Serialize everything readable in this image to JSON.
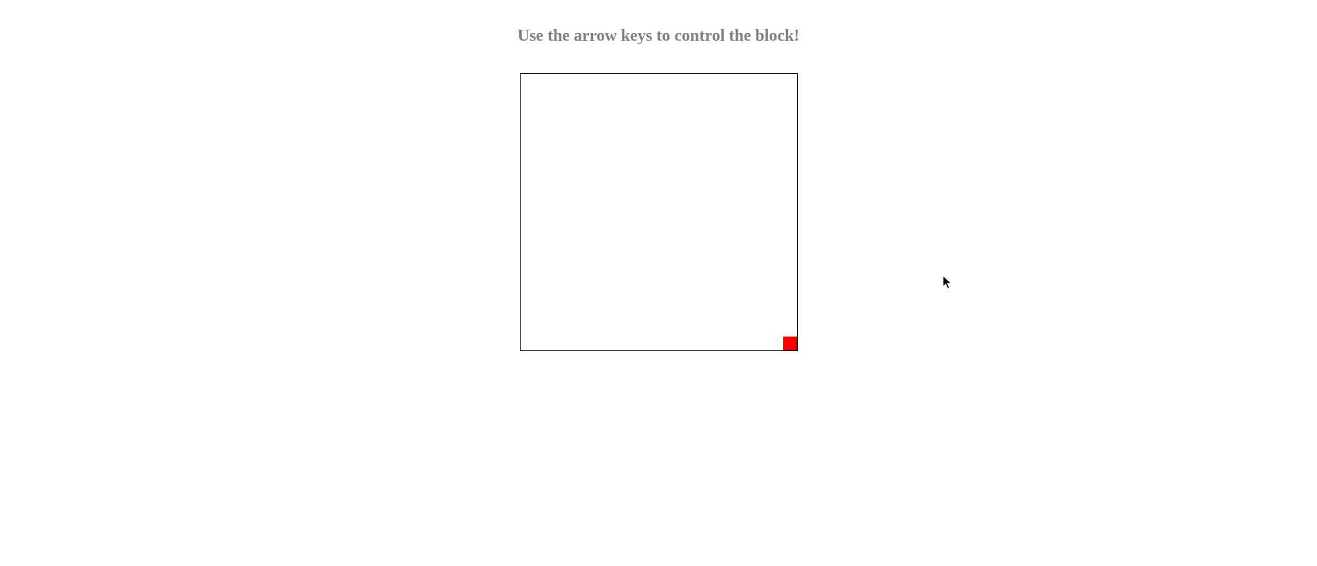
{
  "header": {
    "instruction": "Use the arrow keys to control the block!"
  },
  "game": {
    "block": {
      "color": "#ff0000",
      "col": 19,
      "row": 19,
      "grid_cols": 20,
      "grid_rows": 20
    },
    "arena_border_color": "#000000"
  },
  "icons": {
    "cursor": "mouse-pointer-icon"
  }
}
